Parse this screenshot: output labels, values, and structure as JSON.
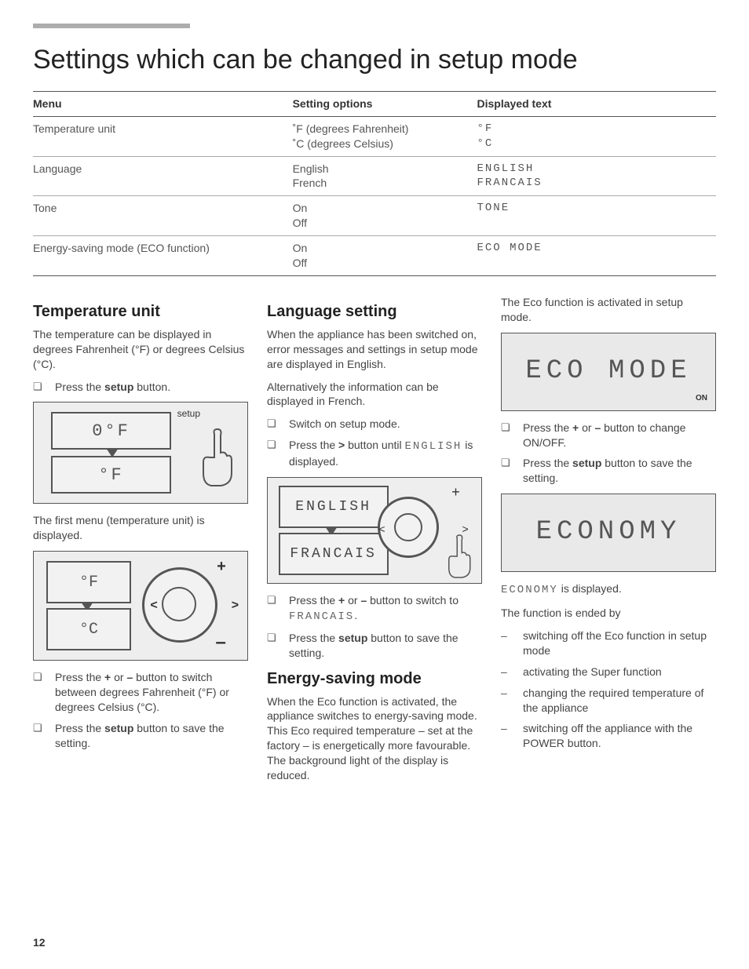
{
  "page_number": "12",
  "title": "Settings which can be changed in setup mode",
  "table": {
    "headers": {
      "menu": "Menu",
      "options": "Setting options",
      "displayed": "Displayed text"
    },
    "rows": [
      {
        "menu": "Temperature unit",
        "options": "˚F (degrees Fahrenheit)\n˚C (degrees Celsius)",
        "displayed": "°F\n°C"
      },
      {
        "menu": "Language",
        "options": "English\nFrench",
        "displayed": "ENGLISH\nFRANCAIS"
      },
      {
        "menu": "Tone",
        "options": "On\nOff",
        "displayed": "TONE"
      },
      {
        "menu": "Energy-saving mode (ECO function)",
        "options": "On\nOff",
        "displayed": "ECO MODE"
      }
    ]
  },
  "temperature": {
    "heading": "Temperature unit",
    "intro": "The temperature can be displayed in degrees Fahrenheit (°F) or degrees Celsius (°C).",
    "step1_pre": "Press the ",
    "step1_bold": "setup",
    "step1_post": " button.",
    "fig1": {
      "top": "0°F",
      "bottom": "°F",
      "setup": "setup"
    },
    "after_fig1": "The first menu (temperature unit) is displayed.",
    "fig2": {
      "top": "°F",
      "bottom": "°C"
    },
    "step2_pre": "Press the ",
    "step2_b1": "+",
    "step2_mid": " or ",
    "step2_b2": "–",
    "step2_post": " button to switch between degrees Fahrenheit (°F) or degrees Celsius (°C).",
    "step3_pre": "Press the ",
    "step3_bold": "setup",
    "step3_post": " button to save the setting."
  },
  "language": {
    "heading": "Language setting",
    "p1": "When the appliance has been switched on, error messages and settings in setup mode are displayed in English.",
    "p2": "Alternatively the information can be displayed in French.",
    "step1": "Switch on setup mode.",
    "step2_pre": "Press the ",
    "step2_bold": ">",
    "step2_mid": " button until ",
    "step2_lcd": "ENGLISH",
    "step2_post": " is displayed.",
    "fig": {
      "top": "ENGLISH",
      "bottom": "FRANCAIS"
    },
    "step3_pre": "Press the ",
    "step3_b1": "+",
    "step3_mid": " or ",
    "step3_b2": "–",
    "step3_mid2": " button to switch to ",
    "step3_lcd": "FRANCAIS",
    "step3_post": ".",
    "step4_pre": "Press the ",
    "step4_bold": "setup",
    "step4_post": " button to save the setting."
  },
  "eco": {
    "heading": "Energy-saving mode",
    "p1": "When the Eco function is activated, the appliance switches to energy-saving mode. This Eco required temperature – set at the factory – is energetically more favourable. The background light of the display is reduced.",
    "p2": "The Eco function is activated in setup mode.",
    "fig1": {
      "text": "ECO MODE",
      "on": "ON"
    },
    "step1_pre": "Press the ",
    "step1_b1": "+",
    "step1_mid": " or ",
    "step1_b2": "–",
    "step1_post": " button to change ON/OFF.",
    "step2_pre": "Press the ",
    "step2_bold": "setup",
    "step2_post": " button to save the setting.",
    "fig2": {
      "text": "ECONOMY"
    },
    "after_fig2_lcd": "ECONOMY",
    "after_fig2_post": " is displayed.",
    "end_intro": "The function is ended by",
    "end_items": [
      "switching off the Eco function in setup mode",
      "activating the Super function",
      "changing the required temperature of the appliance",
      "switching off the appliance with the POWER button."
    ]
  }
}
